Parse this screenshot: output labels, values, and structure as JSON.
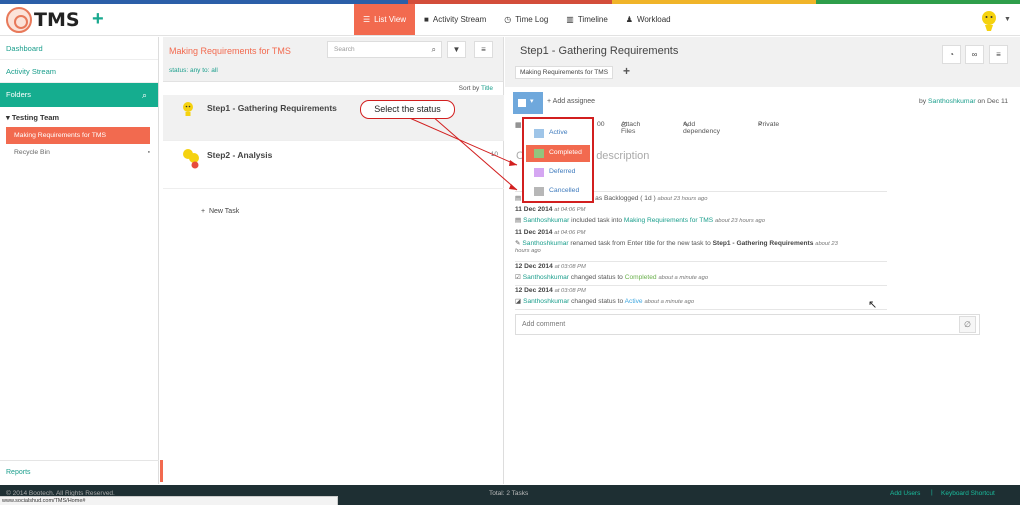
{
  "brand": {
    "name": "TMS"
  },
  "colors": {
    "accent": "#f26a4f",
    "teal": "#15ad8f",
    "status_active": "#9fc5e8",
    "status_completed": "#93c47d",
    "status_deferred": "#d5a6f2",
    "status_cancelled": "#b7b7b7"
  },
  "nav": {
    "items": [
      {
        "label": "List View",
        "icon": "list-icon"
      },
      {
        "label": "Activity Stream",
        "icon": "comment-icon"
      },
      {
        "label": "Time Log",
        "icon": "clock-icon"
      },
      {
        "label": "Timeline",
        "icon": "timeline-icon"
      },
      {
        "label": "Workload",
        "icon": "user-icon"
      }
    ]
  },
  "sidebar": {
    "dashboard": "Dashboard",
    "activity_stream": "Activity Stream",
    "folders": "Folders",
    "team": "Testing Team",
    "active_folder": "Making Requirements for TMS",
    "recycle_bin": "Recycle Bin",
    "reports": "Reports"
  },
  "list": {
    "title": "Making Requirements for TMS",
    "filter": "status: any   to: all",
    "search_placeholder": "Search",
    "sort_prefix": "Sort by",
    "sort_field": "Title",
    "tasks": [
      {
        "title": "Step1 - Gathering Requirements"
      },
      {
        "title": "Step2 - Analysis",
        "due": "10"
      }
    ],
    "new_task": "New Task"
  },
  "detail": {
    "title": "Step1 - Gathering Requirements",
    "folder_chip": "Making Requirements for TMS",
    "add_assignee": "Add assignee",
    "by_prefix": "by",
    "author": "Santhoshkumar",
    "on_date": "on Dec 11",
    "time_fragment": "00",
    "attach_files": "Attach Files",
    "add_dependency": "Add dependency",
    "private": "Private",
    "description_placeholder": "e description",
    "comment_placeholder": "Add comment"
  },
  "status_menu": {
    "items": [
      {
        "label": "Active"
      },
      {
        "label": "Completed"
      },
      {
        "label": "Deferred"
      },
      {
        "label": "Cancelled"
      }
    ]
  },
  "callout": "Select the status",
  "activity": {
    "row1_text": "ask as Backlogged ( 1d )",
    "row1_ago": "about 23 hours ago",
    "date1": "11 Dec 2014",
    "time1": "at 04:06 PM",
    "row2_user": "Santhoshkumar",
    "row2_text": "included task into",
    "row2_link": "Making Requirements for TMS",
    "row2_ago": "about 23 hours ago",
    "date2": "11 Dec 2014",
    "time2": "at 04:06 PM",
    "row3_user": "Santhoshkumar",
    "row3_text": "renamed task from Enter title for the new task to",
    "row3_bold": "Step1 - Gathering Requirements",
    "row3_ago": "about 23",
    "row3_ago2": "hours ago",
    "date3": "12 Dec 2014",
    "time3": "at 03:08 PM",
    "row4_user": "Santhoshkumar",
    "row4_text": "changed status to",
    "row4_status": "Completed",
    "row4_ago": "about a minute ago",
    "date4": "12 Dec 2014",
    "time4": "at 03:08 PM",
    "row5_user": "Santhoshkumar",
    "row5_text": "changed status to",
    "row5_status": "Active",
    "row5_ago": "about a minute ago"
  },
  "footer": {
    "copyright": "© 2014 Bootech. All Rights Reserved.",
    "total": "Total: 2 Tasks",
    "add_users": "Add Users",
    "separator": "|",
    "keyboard": "Keyboard Shortcut"
  },
  "status_url": "www.socialshud.com/TMS/Home#"
}
